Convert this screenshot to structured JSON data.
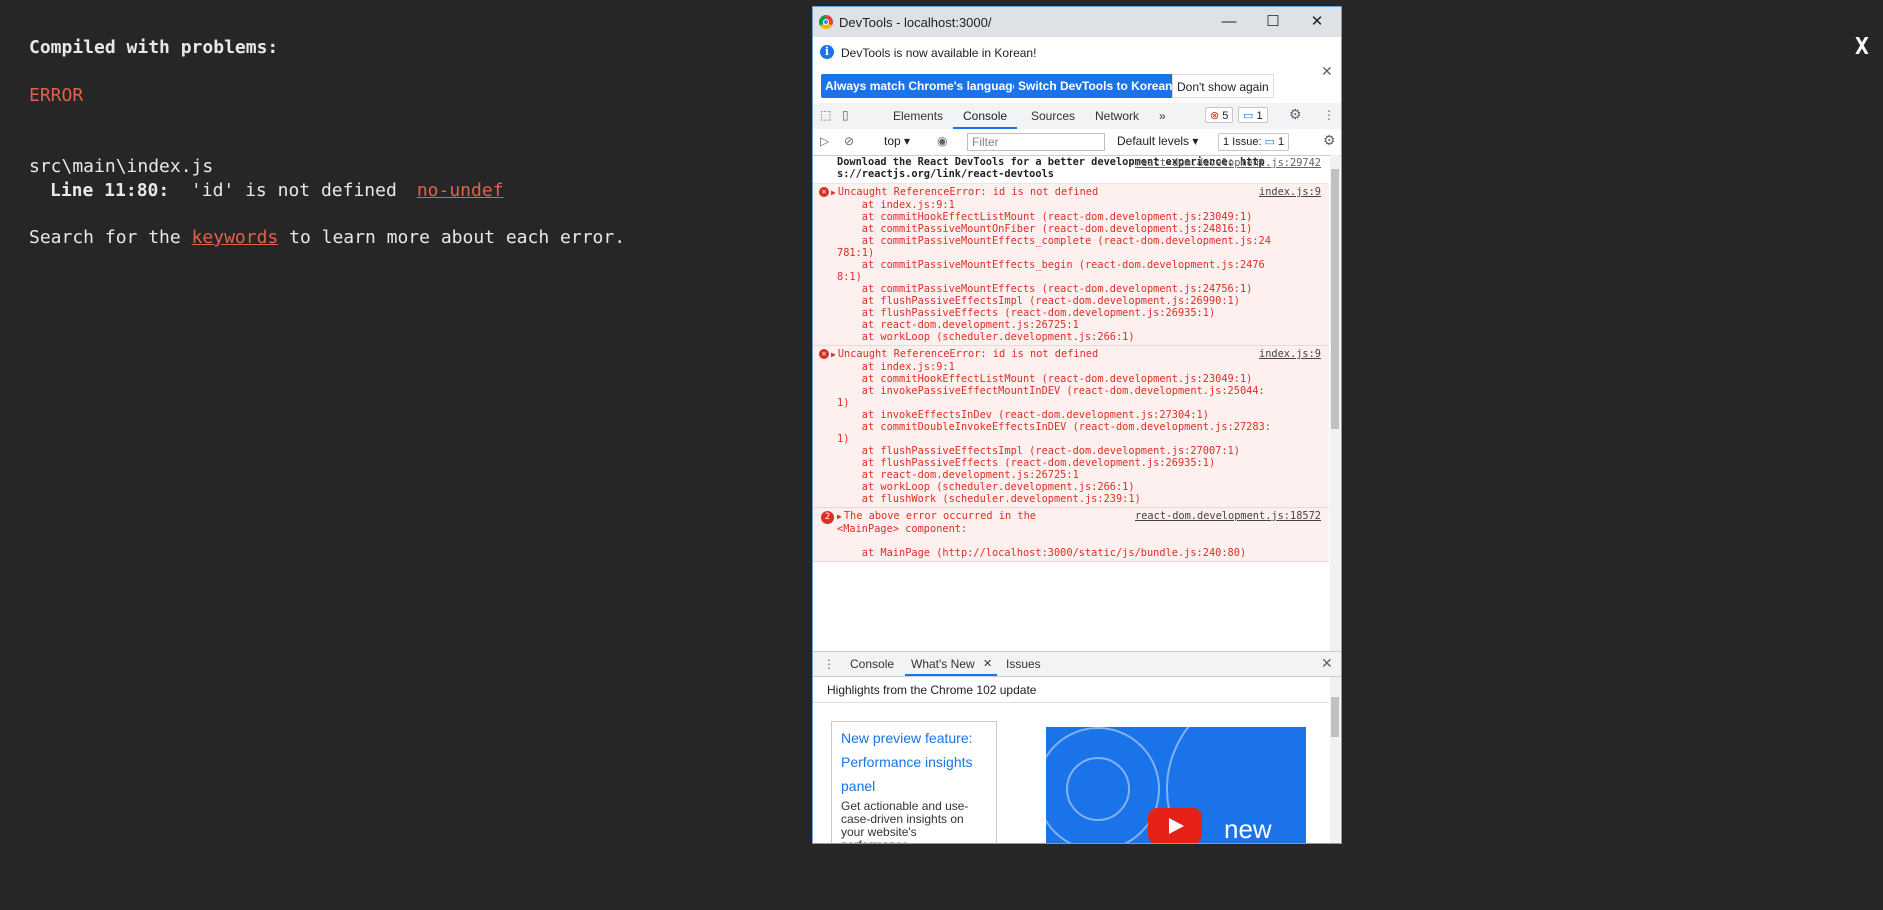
{
  "overlay": {
    "title": "Compiled with problems:",
    "close": "X",
    "error_label": "ERROR",
    "file": "src\\main\\index.js",
    "line_prefix": "Line 11:80:",
    "line_message": "'id' is not defined",
    "rule": "no-undef",
    "search_pre": "Search for the ",
    "search_kw": "keywords",
    "search_post": " to learn more about each error."
  },
  "devtools": {
    "window_title": "DevTools - localhost:3000/",
    "win_minimize": "—",
    "win_maximize": "☐",
    "win_close": "✕",
    "infobar": {
      "text": "DevTools is now available in Korean!",
      "btn_match": "Always match Chrome's language",
      "btn_switch": "Switch DevTools to Korean",
      "btn_dont": "Don't show again"
    },
    "tabs": [
      "Elements",
      "Console",
      "Sources",
      "Network"
    ],
    "more_tabs": "»",
    "errors_count": "5",
    "messages_count": "1",
    "toolbar": {
      "context": "top ▾",
      "filter_placeholder": "Filter",
      "levels": "Default levels ▾",
      "issues": "1 Issue: ",
      "issues_count": "1"
    },
    "console": {
      "info_src": "react-dom.development.js:29742",
      "info_lines": [
        "Download the React DevTools for a better development experience: http",
        "s://reactjs.org/link/react-devtools"
      ],
      "error1": {
        "src": "index.js:9",
        "head": "Uncaught ReferenceError: id is not defined",
        "frames": [
          "    at index.js:9:1",
          "    at commitHookEffectListMount (react-dom.development.js:23049:1)",
          "    at commitPassiveMountOnFiber (react-dom.development.js:24816:1)",
          "    at commitPassiveMountEffects_complete (react-dom.development.js:24",
          "781:1)",
          "    at commitPassiveMountEffects_begin (react-dom.development.js:2476",
          "8:1)",
          "    at commitPassiveMountEffects (react-dom.development.js:24756:1)",
          "    at flushPassiveEffectsImpl (react-dom.development.js:26990:1)",
          "    at flushPassiveEffects (react-dom.development.js:26935:1)",
          "    at react-dom.development.js:26725:1",
          "    at workLoop (scheduler.development.js:266:1)"
        ]
      },
      "error2": {
        "src": "index.js:9",
        "head": "Uncaught ReferenceError: id is not defined",
        "frames": [
          "    at index.js:9:1",
          "    at commitHookEffectListMount (react-dom.development.js:23049:1)",
          "    at invokePassiveEffectMountInDEV (react-dom.development.js:25044:",
          "1)",
          "    at invokeEffectsInDev (react-dom.development.js:27304:1)",
          "    at commitDoubleInvokeEffectsInDEV (react-dom.development.js:27283:",
          "1)",
          "    at flushPassiveEffectsImpl (react-dom.development.js:27007:1)",
          "    at flushPassiveEffects (react-dom.development.js:26935:1)",
          "    at react-dom.development.js:26725:1",
          "    at workLoop (scheduler.development.js:266:1)",
          "    at flushWork (scheduler.development.js:239:1)"
        ]
      },
      "error3": {
        "count": "2",
        "src": "react-dom.development.js:18572",
        "head": "The above error occurred in the",
        "head2": "<MainPage> component:",
        "frame": "    at MainPage (http://localhost:3000/static/js/bundle.js:240:80)"
      }
    },
    "drawer": {
      "menu": "⋮",
      "tabs": [
        "Console",
        "What's New",
        "Issues"
      ],
      "close_tab": "✕",
      "close": "✕"
    },
    "whats_new": {
      "heading": "Highlights from the Chrome 102 update",
      "card_link_1": "New preview feature:",
      "card_link_2": "Performance insights",
      "card_link_3": "panel",
      "card_desc": "Get actionable and use-case-driven insights on your website's performance.",
      "video_text": "new"
    }
  }
}
